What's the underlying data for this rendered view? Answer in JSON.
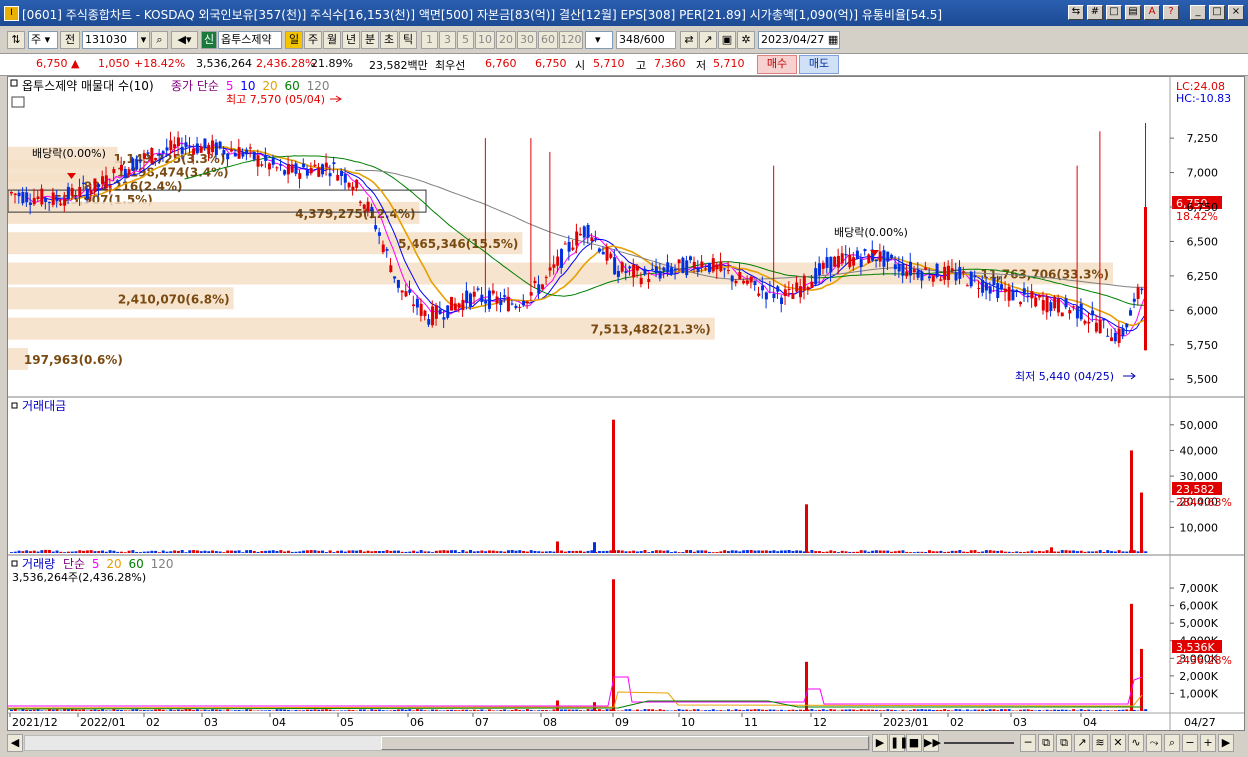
{
  "window": {
    "title": "[0601] 주식종합차트 - KOSDAQ 외국인보유[357(천)] 주식수[16,153(천)] 액면[500] 자본금[83(억)] 결산[12월] EPS[308] PER[21.89] 시가총액[1,090(억)] 유통비율[54.5]",
    "icon_text": "I"
  },
  "toolbar": {
    "market_select": "주",
    "prev_label": "전",
    "code": "131030",
    "company_badge": "신",
    "company_name": "옵투스제약",
    "periods": [
      "일",
      "주",
      "월",
      "년",
      "분",
      "초",
      "틱"
    ],
    "numbers": [
      "1",
      "3",
      "5",
      "10",
      "20",
      "30",
      "60",
      "120"
    ],
    "count": "348",
    "count_total": "/600",
    "date": "2023/04/27"
  },
  "quote": {
    "price": "6,750",
    "change_arrow": "▲",
    "change": "1,050",
    "change_pct": "+18.42%",
    "volume": "3,536,264",
    "volume_pct": "2,436.28%",
    "turnover": "21.89%",
    "amount": "23,582백만",
    "best_label": "최우선",
    "best_ask": "6,760",
    "best_bid": "6,750",
    "open_label": "시",
    "open": "5,710",
    "high_label": "고",
    "high": "7,360",
    "low_label": "저",
    "low": "5,710",
    "buy_button": "매수",
    "sell_button": "매도"
  },
  "price_panel": {
    "title": "옵투스제약 매물대 수(10)",
    "ma_label": "종가 단순",
    "ma_periods": [
      "5",
      "10",
      "20",
      "60",
      "120"
    ],
    "ma_colors": [
      "#ff00ff",
      "#0000ff",
      "#e6a000",
      "#008000",
      "#808080"
    ],
    "lc_label": "LC:24.08",
    "hc_label": "HC:-10.83",
    "high_note": "최고 7,570 (05/04)",
    "low_note": "최저 5,440 (04/25)",
    "dividend_notes": [
      "배당락(0.00%)",
      "배당락(0.00%)"
    ],
    "current_price_tag": "6,750",
    "current_pct_tag": "18.42%",
    "y_ticks": [
      "7,250",
      "7,000",
      "6,750",
      "6,500",
      "6,250",
      "6,000",
      "5,750",
      "5,500"
    ],
    "volume_profile": [
      {
        "label": "1,149,725(3.3%)"
      },
      {
        "label": "1,198,474(3.4%)"
      },
      {
        "label": "831,216(2.4%)"
      },
      {
        "label": "525,907(1.5%)"
      },
      {
        "label": "4,379,275(12.4%)"
      },
      {
        "label": "5,465,346(15.5%)"
      },
      {
        "label": "11,763,706(33.3%)"
      },
      {
        "label": "2,410,070(6.8%)"
      },
      {
        "label": "7,513,482(21.3%)"
      },
      {
        "label": "197,963(0.6%)"
      }
    ]
  },
  "amount_panel": {
    "title": "거래대금",
    "y_ticks": [
      "50,000",
      "40,000",
      "30,000",
      "20,000",
      "10,000"
    ],
    "value_tag": "23,582",
    "pct_tag": "2844.63%"
  },
  "volume_panel": {
    "title": "거래량",
    "ma_label": "단순",
    "ma_periods": [
      "5",
      "20",
      "60",
      "120"
    ],
    "info": "3,536,264주(2,436.28%)",
    "y_ticks": [
      "7,000K",
      "6,000K",
      "5,000K",
      "4,000K",
      "3,000K",
      "2,000K",
      "1,000K"
    ],
    "value_tag": "3,536K",
    "pct_tag": "2436.28%"
  },
  "x_axis": {
    "labels": [
      "2021/12",
      "2022/01",
      "02",
      "03",
      "04",
      "05",
      "06",
      "07",
      "08",
      "09",
      "10",
      "11",
      "12",
      "2023/01",
      "02",
      "03",
      "04"
    ],
    "last_label": "04/27"
  },
  "chart_data": [
    {
      "type": "candlestick",
      "title": "옵투스제약 매물대 수(10)",
      "ylim": [
        5400,
        7650
      ],
      "annotations": {
        "high": 7570,
        "high_date": "05/04",
        "low": 5440,
        "low_date": "04/25",
        "current": 6750
      },
      "series": [
        {
          "name": "5",
          "values": []
        },
        {
          "name": "10",
          "values": []
        },
        {
          "name": "20",
          "values": []
        },
        {
          "name": "60",
          "values": []
        },
        {
          "name": "120",
          "values": []
        }
      ]
    },
    {
      "type": "bar",
      "title": "거래대금",
      "ylim": [
        0,
        55000
      ],
      "spikes": [
        {
          "x": "2022/09",
          "value": 52000
        },
        {
          "x": "2022/12",
          "value": 19000
        },
        {
          "x": "2023/04/26",
          "value": 40000
        },
        {
          "x": "2023/04/27",
          "value": 23582
        }
      ]
    },
    {
      "type": "bar",
      "title": "거래량",
      "ylim": [
        0,
        7800
      ],
      "spikes": [
        {
          "x": "2022/09",
          "value": 7500
        },
        {
          "x": "2022/12",
          "value": 2800
        },
        {
          "x": "2023/04/26",
          "value": 6100
        },
        {
          "x": "2023/04/27",
          "value": 3536
        }
      ]
    }
  ]
}
